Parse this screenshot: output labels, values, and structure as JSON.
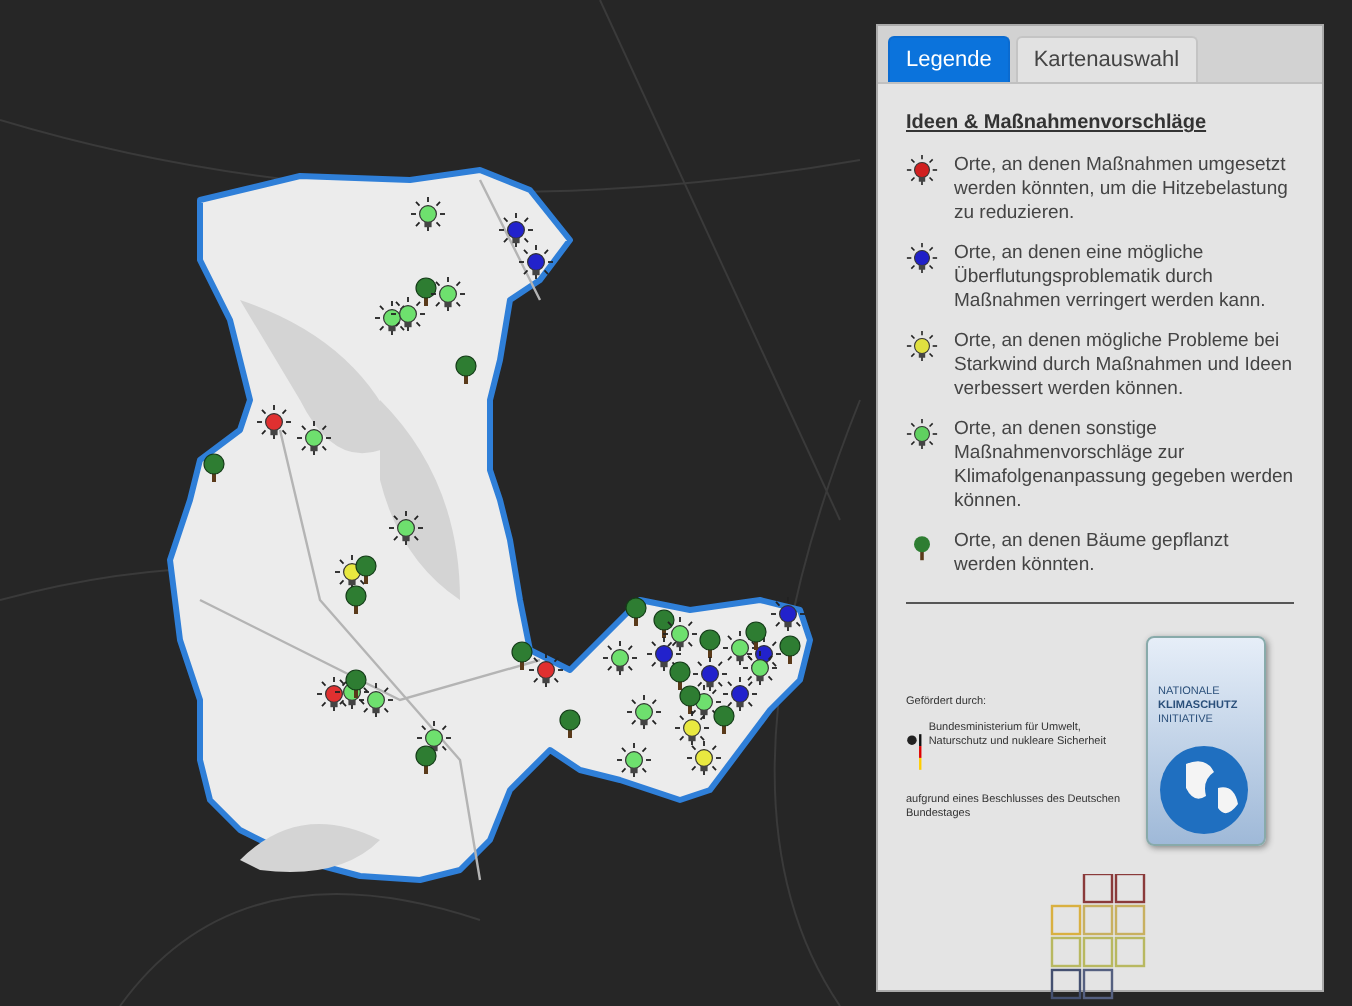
{
  "tabs": [
    {
      "label": "Legende",
      "selected": true
    },
    {
      "label": "Kartenauswahl",
      "selected": false
    }
  ],
  "legend": {
    "title": "Ideen & Maßnahmenvorschläge",
    "items": [
      {
        "kind": "bulb",
        "color": "#d02020",
        "text": "Orte, an denen Maßnahmen umgesetzt werden könnten, um die Hitzebelastung zu reduzieren."
      },
      {
        "kind": "bulb",
        "color": "#2020c8",
        "text": "Orte, an denen eine mögliche Überflutungsproblematik durch Maßnahmen verringert werden kann."
      },
      {
        "kind": "bulb",
        "color": "#e0e040",
        "text": "Orte, an denen mögliche Probleme bei Starkwind durch Maßnahmen und Ideen verbessert werden können."
      },
      {
        "kind": "bulb",
        "color": "#60d060",
        "text": "Orte, an denen sonstige Maßnahmenvorschläge zur Klimafolgenanpassung gegeben werden können."
      },
      {
        "kind": "tree",
        "color": "#2e7d32",
        "text": "Orte, an denen Bäume gepflanzt werden könnten."
      }
    ]
  },
  "sponsor": {
    "funded_by": "Gefördert durch:",
    "ministry": "Bundesministerium für Umwelt, Naturschutz und nukleare Sicherheit",
    "basis": "aufgrund eines Beschlusses des Deutschen Bundestages",
    "initiative_line_1": "NATIONALE",
    "initiative_line_2": "KLIMASCHUTZ",
    "initiative_line_3": "INITIATIVE"
  }
}
